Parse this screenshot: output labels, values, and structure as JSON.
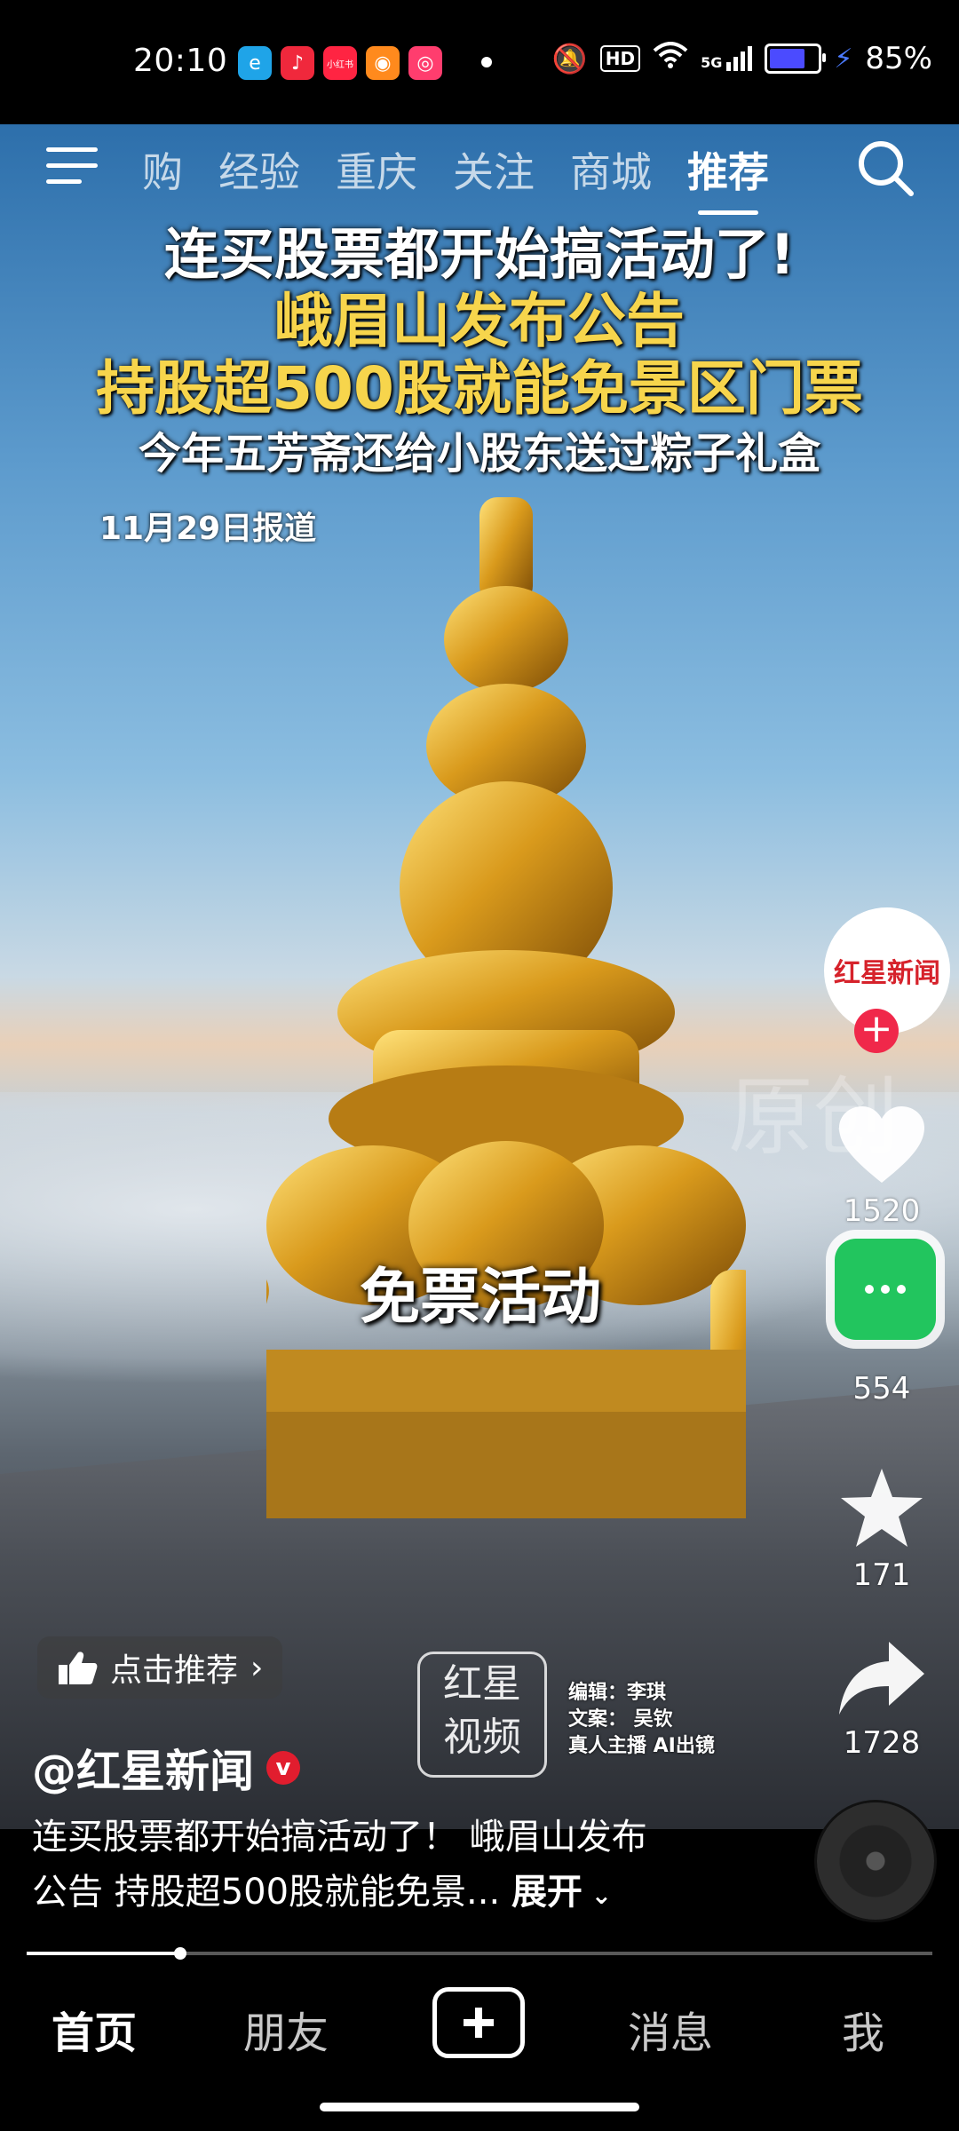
{
  "status": {
    "time": "20:10",
    "battery_pct": "85%",
    "network": "5G",
    "hd": "HD",
    "battery_level": 0.85
  },
  "apps": [
    {
      "name": "edge-icon",
      "color": "#1fa4e8",
      "glyph": "e"
    },
    {
      "name": "music-icon",
      "color": "#f0283c",
      "glyph": "♪"
    },
    {
      "name": "xiaohongshu-icon",
      "color": "#ff2442",
      "glyph": "小红书"
    },
    {
      "name": "app-orange-icon",
      "color": "#ff8a1d",
      "glyph": "◉"
    },
    {
      "name": "app-pink-icon",
      "color": "#ff3d6e",
      "glyph": "◎"
    }
  ],
  "topnav": {
    "tabs": [
      "购",
      "经验",
      "重庆",
      "关注",
      "商城",
      "推荐"
    ],
    "active_tab": "推荐"
  },
  "headline": {
    "line1": "连买股票都开始搞活动了!",
    "line2": "峨眉山发布公告",
    "line3": "持股超500股就能免景区门票",
    "line4": "今年五芳斋还给小股东送过粽子礼盒",
    "date": "11月29日报道"
  },
  "overlay": {
    "watermark": "原创",
    "caption": "免票活动",
    "recommend": "点击推荐",
    "logo_line1": "红星",
    "logo_line2": "视频",
    "credits": [
      "编辑：李琪",
      "文案： 吴钦",
      "真人主播 AI出镜"
    ]
  },
  "side": {
    "avatar_text": "红星新闻",
    "likes": "1520",
    "comments": "554",
    "favorites": "171",
    "shares": "1728"
  },
  "post": {
    "author": "@红星新闻",
    "verified_badge": "v",
    "desc_line1": "连买股票都开始搞活动了！ 峨眉山发布",
    "desc_line2": "公告 持股超500股就能免景...",
    "expand": "展开"
  },
  "progress": 0.17,
  "bottomnav": {
    "home": "首页",
    "friends": "朋友",
    "messages": "消息",
    "me": "我"
  }
}
